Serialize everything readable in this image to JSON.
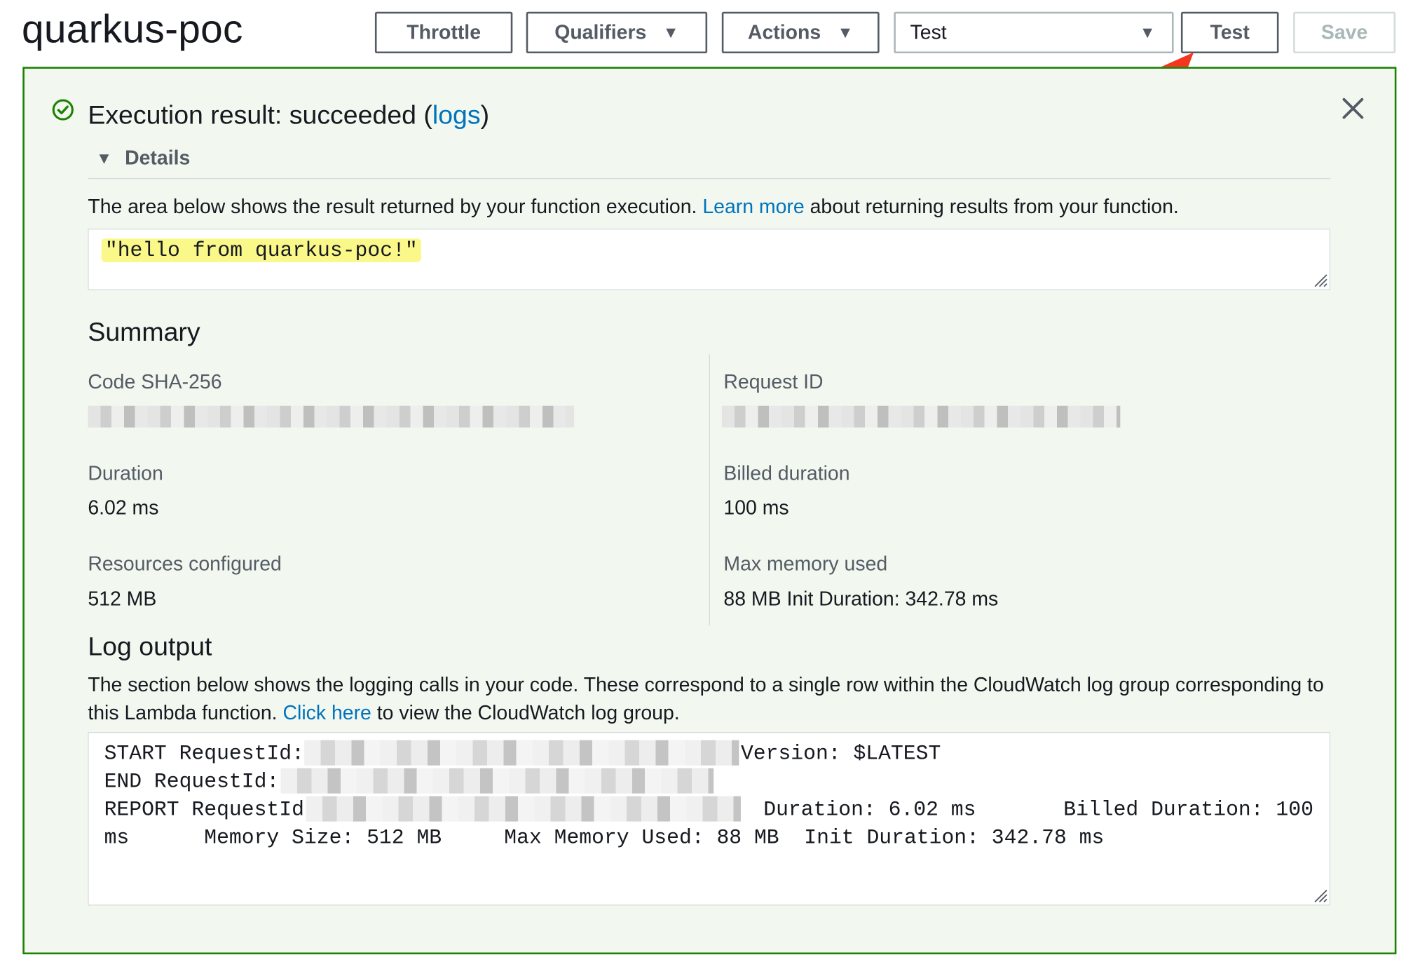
{
  "function_name": "quarkus-poc",
  "toolbar": {
    "throttle_label": "Throttle",
    "qualifiers_label": "Qualifiers",
    "actions_label": "Actions",
    "test_event_selected": "Test",
    "test_label": "Test",
    "save_label": "Save",
    "caret": "▼"
  },
  "result": {
    "heading_prefix": "Execution result: succeeded (",
    "logs_link": "logs",
    "heading_suffix": ")",
    "status_color": "#1d8102",
    "details_label": "Details",
    "details_toggle": "▼",
    "description_prefix": "The area below shows the result returned by your function execution.",
    "learn_more_link": "Learn more",
    "description_suffix": "about returning results from your function.",
    "output": "\"hello from quarkus-poc!\""
  },
  "summary": {
    "heading": "Summary",
    "code_sha_label": "Code SHA-256",
    "request_id_label": "Request ID",
    "duration_label": "Duration",
    "duration_value": "6.02 ms",
    "billed_duration_label": "Billed duration",
    "billed_duration_value": "100 ms",
    "resources_label": "Resources configured",
    "resources_value": "512 MB",
    "max_memory_label": "Max memory used",
    "max_memory_value": "88 MB Init Duration: 342.78 ms"
  },
  "log_output": {
    "heading": "Log output",
    "description_1": "The section below shows the logging calls in your code. These correspond to a single row within the CloudWatch log group corresponding to this Lambda function.",
    "click_here_link": "Click here",
    "description_2": "to view the CloudWatch log group.",
    "line_start": "START RequestId:",
    "line_start_version": "Version: $LATEST",
    "line_end": "END RequestId:",
    "line_report": "REPORT RequestId:",
    "line_report_tail": "Duration: 6.02 ms       Billed Duration: 100",
    "line_report_2": "ms      Memory Size: 512 MB     Max Memory Used: 88 MB  Init Duration: 342.78 ms"
  },
  "colors": {
    "accent_link": "#0073bb",
    "success_green": "#1d8102",
    "panel_bg": "#f2f8f0",
    "highlight": "#fbf88a",
    "annotation_arrow": "#f4361e"
  }
}
